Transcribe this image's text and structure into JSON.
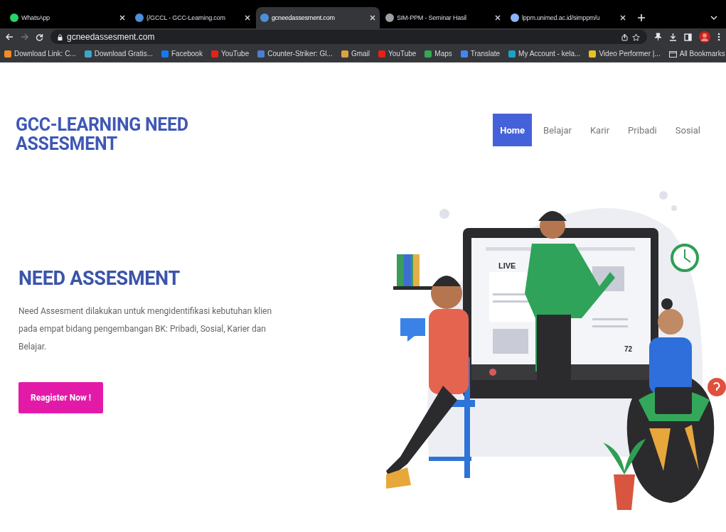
{
  "browser": {
    "tabs": [
      {
        "title": "WhatsApp",
        "selected": false,
        "color": "#25d366"
      },
      {
        "title": "(/GCCL - GCC-Learning.com",
        "selected": false,
        "color": "#4a90d9"
      },
      {
        "title": "gcneedassesment.com",
        "selected": true,
        "color": "#4a90d9"
      },
      {
        "title": "SIM-PPM - Seminar Hasil",
        "selected": false,
        "color": "#9aa0a6"
      },
      {
        "title": "lppm.unimed.ac.id/simppm/u",
        "selected": false,
        "color": "#8ab4f8"
      }
    ],
    "url": "gcneedassesment.com",
    "bookmarks": [
      {
        "label": "Download Link: C...",
        "color": "#f28b22"
      },
      {
        "label": "Download Gratis...",
        "color": "#3ea6c8"
      },
      {
        "label": "Facebook",
        "color": "#1877f2"
      },
      {
        "label": "YouTube",
        "color": "#e62117"
      },
      {
        "label": "Counter-Striker: Gl...",
        "color": "#4a7fd4"
      },
      {
        "label": "Gmail",
        "color": "#d9a441"
      },
      {
        "label": "YouTube",
        "color": "#e62117"
      },
      {
        "label": "Maps",
        "color": "#34a853"
      },
      {
        "label": "Translate",
        "color": "#4285f4"
      },
      {
        "label": "My Account - kela...",
        "color": "#1aa3c4"
      },
      {
        "label": "Video Performer |...",
        "color": "#e6c229"
      }
    ],
    "all_bookmarks": "All Bookmarks"
  },
  "site": {
    "title": "GCC-LEARNING NEED ASSESMENT",
    "nav": [
      {
        "label": "Home",
        "selected": true
      },
      {
        "label": "Belajar",
        "selected": false
      },
      {
        "label": "Karir",
        "selected": false
      },
      {
        "label": "Pribadi",
        "selected": false
      },
      {
        "label": "Sosial",
        "selected": false
      }
    ],
    "hero": {
      "heading": "NEED ASSESMENT",
      "text": "Need Assesment dilakukan untuk mengidentifikasi kebutuhan klien pada empat bidang pengembangan BK: Pribadi, Sosial, Karier dan Belajar.",
      "button": "Reagister Now !"
    },
    "illustration": {
      "live_label": "LIVE",
      "viewer_count": "72"
    }
  }
}
